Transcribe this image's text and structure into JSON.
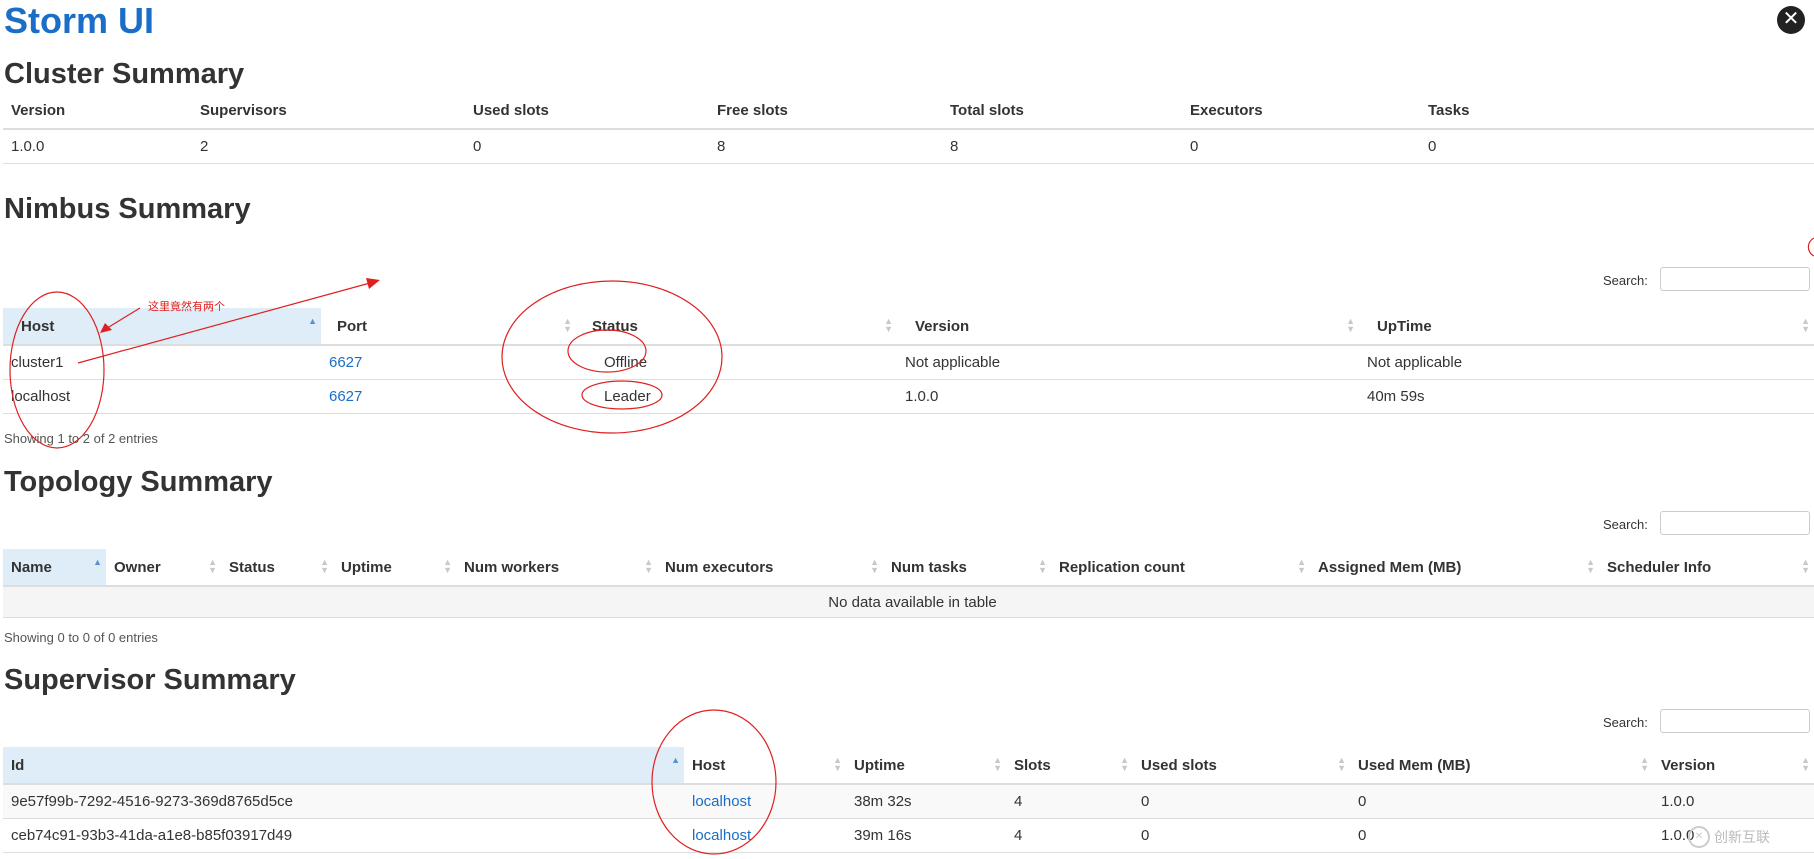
{
  "app_title": "Storm UI",
  "cluster_summary": {
    "title": "Cluster Summary",
    "columns": [
      "Version",
      "Supervisors",
      "Used slots",
      "Free slots",
      "Total slots",
      "Executors",
      "Tasks"
    ],
    "row": [
      "1.0.0",
      "2",
      "0",
      "8",
      "8",
      "0",
      "0"
    ]
  },
  "nimbus_summary": {
    "title": "Nimbus Summary",
    "search_label": "Search:",
    "columns": [
      "Host",
      "Port",
      "Status",
      "Version",
      "UpTime"
    ],
    "rows": [
      [
        "cluster1",
        "6627",
        "Offline",
        "Not applicable",
        "Not applicable"
      ],
      [
        "localhost",
        "6627",
        "Leader",
        "1.0.0",
        "40m 59s"
      ]
    ],
    "info": "Showing 1 to 2 of 2 entries",
    "annotation": "这里竟然有两个"
  },
  "topology_summary": {
    "title": "Topology Summary",
    "search_label": "Search:",
    "columns": [
      "Name",
      "Owner",
      "Status",
      "Uptime",
      "Num workers",
      "Num executors",
      "Num tasks",
      "Replication count",
      "Assigned Mem (MB)",
      "Scheduler Info"
    ],
    "empty_text": "No data available in table",
    "info": "Showing 0 to 0 of 0 entries"
  },
  "supervisor_summary": {
    "title": "Supervisor Summary",
    "search_label": "Search:",
    "columns": [
      "Id",
      "Host",
      "Uptime",
      "Slots",
      "Used slots",
      "Used Mem (MB)",
      "Version"
    ],
    "rows": [
      [
        "9e57f99b-7292-4516-9273-369d8765d5ce",
        "localhost",
        "38m 32s",
        "4",
        "0",
        "0",
        "1.0.0"
      ],
      [
        "ceb74c91-93b3-41da-a1e8-b85f03917d49",
        "localhost",
        "39m 16s",
        "4",
        "0",
        "0",
        "1.0.0"
      ]
    ]
  },
  "watermark": {
    "text": "创新互联"
  },
  "colors": {
    "title_blue": "#1a6ec7",
    "link_blue": "#1a6ec7",
    "sorted_header_bg": "#deedf7",
    "annotation_red": "#e02020"
  }
}
